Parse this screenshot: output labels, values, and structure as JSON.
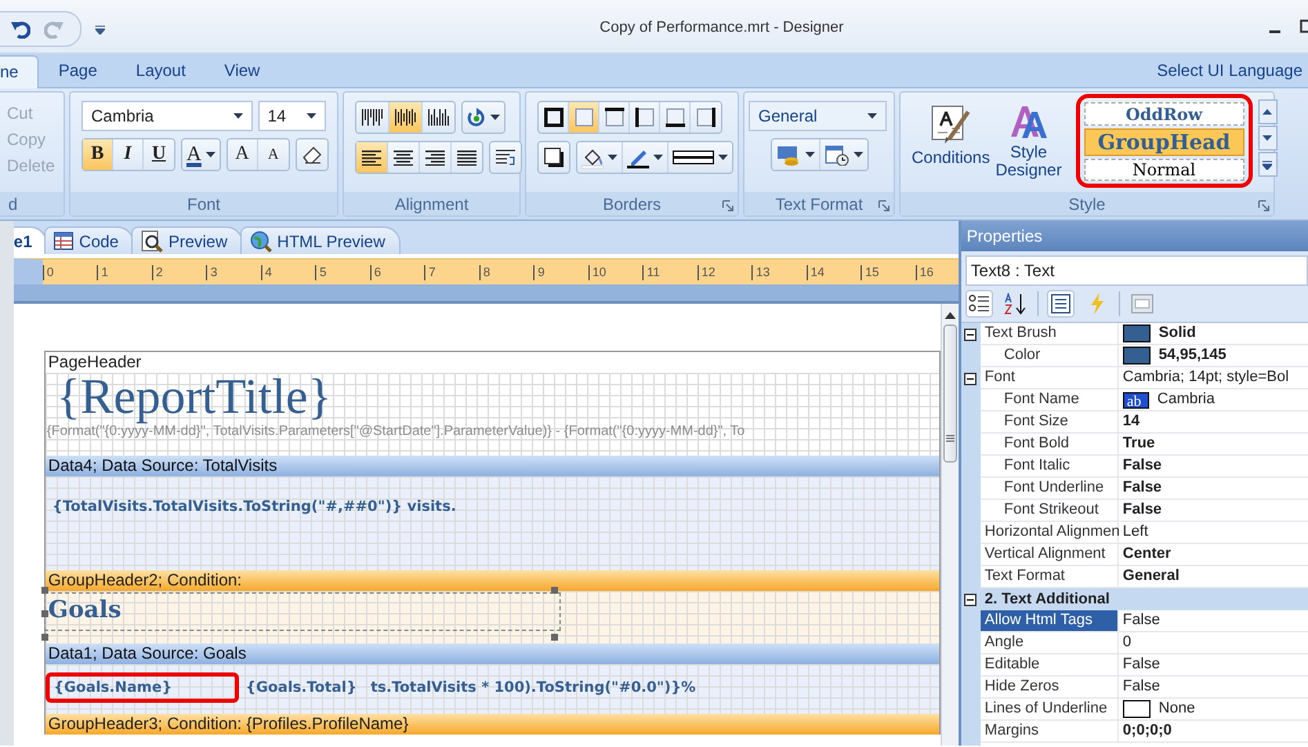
{
  "window": {
    "title": "Copy of Performance.mrt - Designer"
  },
  "ribbon": {
    "tabs": [
      {
        "label": "ne",
        "selected": true
      },
      {
        "label": "Page",
        "selected": false
      },
      {
        "label": "Layout",
        "selected": false
      },
      {
        "label": "View",
        "selected": false
      }
    ],
    "language_link": "Select UI Language",
    "clipboard": {
      "label": "d",
      "items": [
        {
          "label": "Cut",
          "disabled": true
        },
        {
          "label": "Copy",
          "disabled": true
        },
        {
          "label": "Delete",
          "disabled": true
        }
      ]
    },
    "font": {
      "label": "Font",
      "font_name": "Cambria",
      "font_size": "14",
      "styles": [
        {
          "kind": "bold",
          "text": "B",
          "selected": true
        },
        {
          "kind": "italic",
          "text": "I",
          "selected": false
        },
        {
          "kind": "underline",
          "text": "U",
          "selected": false
        }
      ],
      "color_button": "A",
      "grow_button": "A",
      "shrink_button": "A"
    },
    "alignment": {
      "label": "Alignment",
      "vertical": [
        {
          "kind": "top",
          "selected": false
        },
        {
          "kind": "middle",
          "selected": true
        },
        {
          "kind": "bottom",
          "selected": false
        }
      ],
      "horizontal": [
        {
          "kind": "left",
          "selected": true
        },
        {
          "kind": "center",
          "selected": false
        },
        {
          "kind": "right",
          "selected": false
        },
        {
          "kind": "justify",
          "selected": false
        }
      ]
    },
    "borders": {
      "label": "Borders",
      "sides": [
        {
          "kind": "all",
          "selected": false
        },
        {
          "kind": "none",
          "selected": true
        },
        {
          "kind": "top",
          "selected": false
        },
        {
          "kind": "left",
          "selected": false
        },
        {
          "kind": "bottom",
          "selected": false
        },
        {
          "kind": "right",
          "selected": false
        }
      ]
    },
    "text_format": {
      "label": "Text Format",
      "format": "General"
    },
    "style": {
      "label": "Style",
      "conditions": "Conditions",
      "style_designer": "Style Designer",
      "highlighted": true,
      "styles": [
        {
          "kind": "odd_row",
          "name": "OddRow",
          "selected": false
        },
        {
          "kind": "group_head",
          "name": "GroupHead",
          "selected": true
        },
        {
          "kind": "normal",
          "name": "Normal",
          "selected": false
        }
      ]
    }
  },
  "document_tabs": [
    {
      "kind": "page",
      "label": "e1",
      "selected": true
    },
    {
      "kind": "code",
      "label": "Code",
      "selected": false
    },
    {
      "kind": "preview",
      "label": "Preview",
      "selected": false
    },
    {
      "kind": "html",
      "label": "HTML Preview",
      "selected": false
    }
  ],
  "ruler": [
    "0",
    "1",
    "2",
    "3",
    "4",
    "5",
    "6",
    "7",
    "8",
    "9",
    "10",
    "11",
    "12",
    "13",
    "14",
    "15",
    "16"
  ],
  "bands": [
    {
      "kind": "page",
      "title": "PageHeader",
      "items": [
        {
          "kind": "title",
          "text": "{ReportTitle}"
        },
        {
          "kind": "expression",
          "text": "{Format(\"{0:yyyy-MM-dd}\", TotalVisits.Parameters[\"@StartDate\"].ParameterValue)} - {Format(\"{0:yyyy-MM-dd}\", To"
        }
      ]
    },
    {
      "kind": "data",
      "title": "Data4; Data Source: TotalVisits",
      "items": [
        {
          "kind": "field",
          "text": "{TotalVisits.TotalVisits.ToString(\"#,##0\")} visits.",
          "highlighted": false
        }
      ]
    },
    {
      "kind": "group",
      "title": "GroupHeader2; Condition:",
      "items": [
        {
          "kind": "heading",
          "text": "Goals",
          "selected": true
        }
      ]
    },
    {
      "kind": "data",
      "title": "Data1; Data Source: Goals",
      "items": [
        {
          "kind": "field",
          "text": "{Goals.Name}",
          "highlighted": true
        },
        {
          "kind": "field",
          "text": "{Goals.Total}",
          "highlighted": false
        },
        {
          "kind": "field",
          "text": "ts.TotalVisits * 100).ToString(\"#0.0\")}%",
          "highlighted": false
        }
      ]
    },
    {
      "kind": "group",
      "title": "GroupHeader3; Condition: {Profiles.ProfileName}"
    }
  ],
  "properties": {
    "title": "Properties",
    "object": "Text8 : Text",
    "rows": [
      {
        "label": "Text Brush",
        "value": "Solid",
        "color": "#365f91",
        "modified": true,
        "selected": false,
        "expanded": true,
        "children": [
          {
            "label": "Color",
            "value": "54,95,145",
            "color": "#365f91",
            "modified": true,
            "selected": false
          }
        ]
      },
      {
        "label": "Font",
        "value": "Cambria; 14pt; style=Bol",
        "modified": false,
        "selected": false,
        "expanded": true,
        "children": [
          {
            "label": "Font Name",
            "value": "Cambria",
            "preview": "ab",
            "modified": false,
            "selected": false
          },
          {
            "label": "Font Size",
            "value": "14",
            "modified": true,
            "selected": false
          },
          {
            "label": "Font Bold",
            "value": "True",
            "modified": true,
            "selected": false
          },
          {
            "label": "Font Italic",
            "value": "False",
            "modified": true,
            "selected": false
          },
          {
            "label": "Font Underline",
            "value": "False",
            "modified": true,
            "selected": false
          },
          {
            "label": "Font Strikeout",
            "value": "False",
            "modified": true,
            "selected": false
          }
        ]
      },
      {
        "label": "Horizontal Alignmen",
        "value": "Left",
        "modified": false,
        "selected": false
      },
      {
        "label": "Vertical Alignment",
        "value": "Center",
        "modified": true,
        "selected": false
      },
      {
        "label": "Text Format",
        "value": "General",
        "modified": true,
        "selected": false
      }
    ],
    "sections": [
      {
        "label": "2. Text  Additional",
        "expanded": true,
        "rows": [
          {
            "label": "Allow Html Tags",
            "value": "False",
            "modified": false,
            "selected": true
          },
          {
            "label": "Angle",
            "value": "0",
            "modified": false,
            "selected": false
          },
          {
            "label": "Editable",
            "value": "False",
            "modified": false,
            "selected": false
          },
          {
            "label": "Hide Zeros",
            "value": "False",
            "modified": false,
            "selected": false
          },
          {
            "label": "Lines of Underline",
            "value": "None",
            "color": "#ffffff",
            "modified": false,
            "selected": false
          },
          {
            "label": "Margins",
            "value": "0;0;0;0",
            "modified": true,
            "selected": false
          }
        ]
      }
    ]
  }
}
